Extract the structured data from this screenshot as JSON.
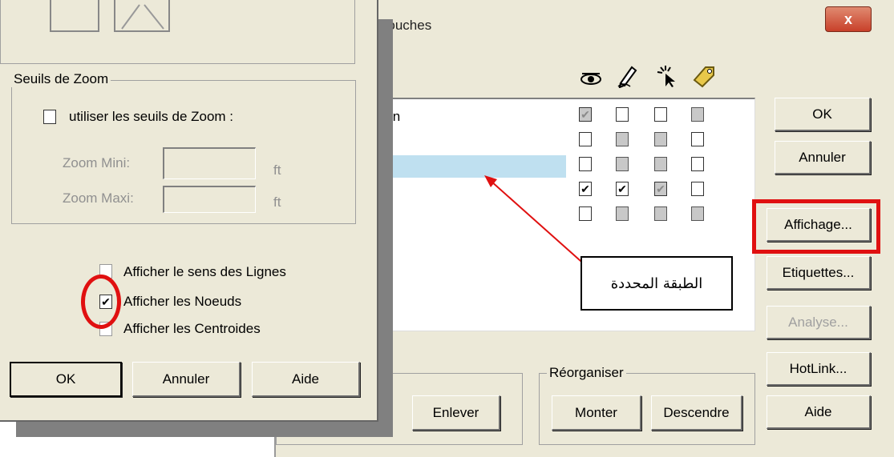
{
  "right_dialog": {
    "title": "Contrôle des Couches",
    "close_label": "x",
    "layer_partial_name": "ssin",
    "column_icons": [
      "eye-icon",
      "pencil-icon",
      "cursor-icon",
      "tag-icon"
    ],
    "rows": [
      [
        "gchk",
        "empty",
        "empty",
        "gray"
      ],
      [
        "empty",
        "gray",
        "gray",
        "empty"
      ],
      [
        "empty",
        "gray",
        "gray",
        "empty"
      ],
      [
        "chk",
        "chk",
        "gchk",
        "empty"
      ],
      [
        "empty",
        "gray",
        "gray",
        "gray"
      ]
    ],
    "buttons": {
      "ok": "OK",
      "cancel": "Annuler",
      "display": "Affichage...",
      "labels": "Etiquettes...",
      "analysis": "Analyse...",
      "hotlink": "HotLink...",
      "help": "Aide",
      "remove": "Enlever",
      "up": "Monter",
      "down": "Descendre"
    },
    "reorganize_legend": "Réorganiser"
  },
  "left_dialog": {
    "zoom_legend": "Seuils de Zoom",
    "use_zoom_label": "utiliser les seuils de Zoom :",
    "zoom_min_label": "Zoom Mini:",
    "zoom_max_label": "Zoom Maxi:",
    "unit_min": "ft",
    "unit_max": "ft",
    "show_direction_label": "Afficher le sens des Lignes",
    "show_nodes_label": "Afficher les Noeuds",
    "show_centroids_label": "Afficher les Centroides",
    "ok": "OK",
    "cancel": "Annuler",
    "help": "Aide"
  },
  "annotation": {
    "callout_text": "الطبقة المحددة"
  },
  "colors": {
    "dialog_bg": "#ece9d8",
    "highlight": "#bfe0f0",
    "accent_red": "#e01010",
    "close_red": "#c8402a"
  }
}
